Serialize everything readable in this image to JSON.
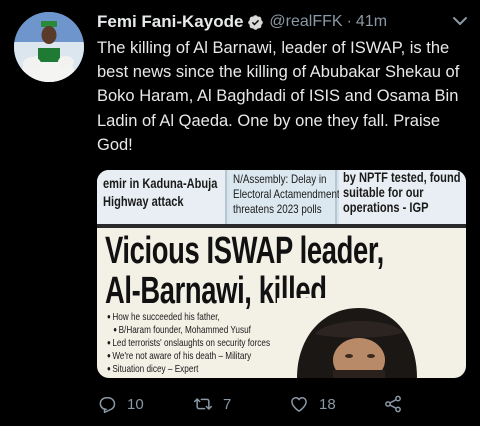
{
  "tweet": {
    "author_name": "Femi Fani-Kayode",
    "handle": "@realFFK",
    "separator": "·",
    "time": "41m",
    "text": "The killing of Al Barnawi, leader of ISWAP, is the best news since the killing of Abubakar Shekau of  Boko Haram, Al Baghdadi of ISIS and Osama Bin Ladin of Al Qaeda. One by one they fall. Praise God!",
    "verified_icon": "verified-badge-icon",
    "menu_icon": "chevron-down-icon"
  },
  "newspaper": {
    "strip": [
      {
        "text_lines": [
          "emir in Kaduna-Abuja",
          "Highway attack"
        ]
      },
      {
        "text_lines": [
          "N/Assembly: Delay in",
          "Electoral Actamendment",
          "threatens 2023 polls"
        ]
      },
      {
        "text_lines": [
          "by NPTF tested, found",
          "suitable for our",
          "operations - IGP"
        ]
      }
    ],
    "headline_line1": "Vicious ISWAP leader,",
    "headline_line2": "Al-Barnawi, killed",
    "bullets": [
      "How he succeeded his father,",
      "B/Haram founder, Mohammed Yusuf",
      "Led terrorists' onslaughts on security forces",
      "We're not aware of his death – Military",
      "Situation dicey – Expert"
    ]
  },
  "actions": {
    "reply": {
      "icon": "reply-icon",
      "count": "10"
    },
    "retweet": {
      "icon": "retweet-icon",
      "count": "7"
    },
    "like": {
      "icon": "heart-icon",
      "count": "18"
    },
    "share": {
      "icon": "share-icon"
    }
  },
  "colors": {
    "background": "#000000",
    "text_primary": "#e7e9ea",
    "text_secondary": "#8b98a5",
    "verified": "#1d9bf0"
  }
}
